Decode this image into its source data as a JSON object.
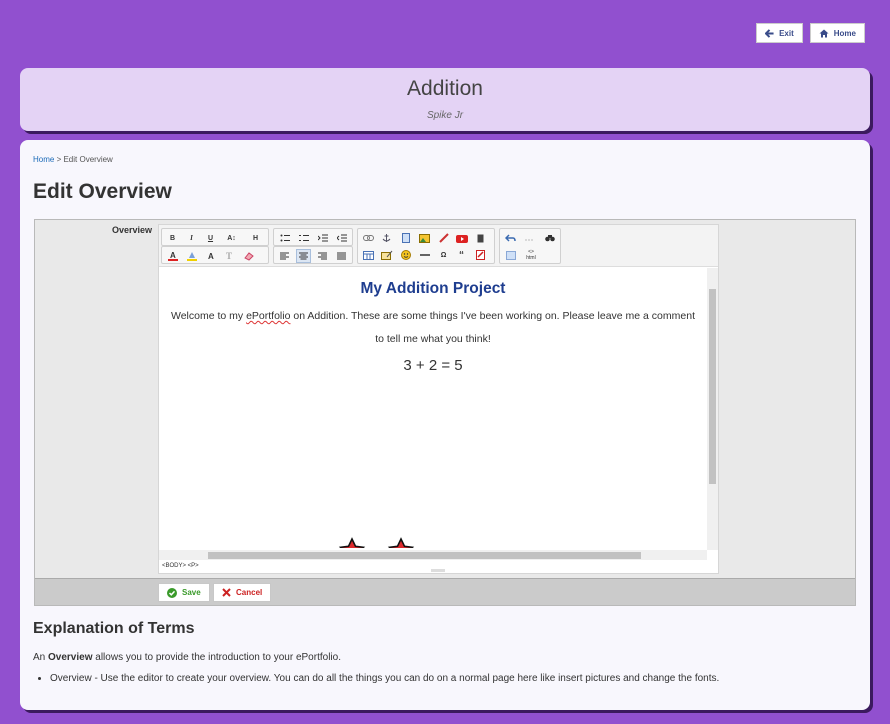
{
  "nav": {
    "exit_label": "Exit",
    "home_label": "Home"
  },
  "header": {
    "title": "Addition",
    "subtitle": "Spike Jr"
  },
  "breadcrumb": {
    "home": "Home",
    "separator": " > ",
    "current": "Edit Overview"
  },
  "page_title": "Edit Overview",
  "form": {
    "field_label": "Overview",
    "save_label": "Save",
    "cancel_label": "Cancel"
  },
  "editor": {
    "toolbar": {
      "bold": "B",
      "italic": "I",
      "underline": "U",
      "font_size": "A↕",
      "heading": "H",
      "special_char": "Ω",
      "quote": "“",
      "html_top": "<>",
      "html_bottom": "html"
    },
    "content": {
      "title": "My Addition Project",
      "para_before": "Welcome to my ",
      "para_link": "ePortfolio",
      "para_after": " on Addition. These are some things I've been working on. Please leave me a comment",
      "para2": "to tell me what you think!",
      "equation": "3 + 2 = 5"
    },
    "path": "<BODY>  <P>"
  },
  "explanation": {
    "heading": "Explanation of Terms",
    "intro_prefix": "An ",
    "intro_term": "Overview",
    "intro_suffix": " allows you to provide the introduction to your ePortfolio.",
    "bullets": [
      "Overview - Use the editor to create your overview. You can do all the things you can do on a normal page here like insert pictures and change the fonts."
    ]
  },
  "icons": [
    "arrow-left-icon",
    "home-icon",
    "check-circle-icon",
    "x-icon",
    "star-icon",
    "arrow-down-icon"
  ],
  "colors": {
    "background": "#9150cf",
    "header_panel": "#e4d3f5",
    "link": "#1c6bb8",
    "doc_title": "#1e3d8f",
    "red_star": "#dd2a2d",
    "blue_star": "#3f46c1",
    "save": "#3a9a2a",
    "cancel": "#cc2222"
  }
}
